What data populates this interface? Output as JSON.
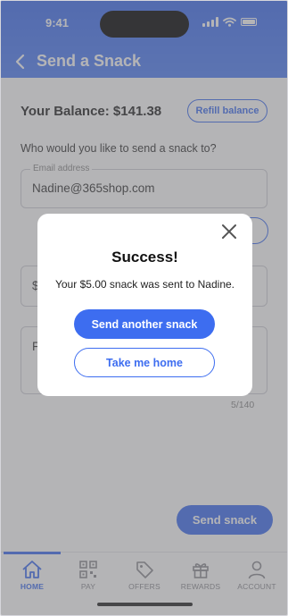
{
  "status_bar": {
    "time": "9:41"
  },
  "header": {
    "title": "Send a Snack"
  },
  "balance": {
    "label": "Your Balance: $141.38",
    "refill_label": "Refill balance"
  },
  "form": {
    "question": "Who would you like to send a snack to?",
    "email_label": "Email address",
    "email_value": "Nadine@365shop.com",
    "amount_fragment": "$",
    "message_fragment": "F",
    "char_counter": "5/140"
  },
  "send_button": "Send snack",
  "tabs": [
    {
      "label": "HOME",
      "icon": "home-icon",
      "active": true
    },
    {
      "label": "PAY",
      "icon": "qr-code-icon",
      "active": false
    },
    {
      "label": "OFFERS",
      "icon": "tag-icon",
      "active": false
    },
    {
      "label": "REWARDS",
      "icon": "gift-icon",
      "active": false
    },
    {
      "label": "ACCOUNT",
      "icon": "person-icon",
      "active": false
    }
  ],
  "modal": {
    "title": "Success!",
    "message": "Your $5.00 snack was sent to Nadine.",
    "primary_button": "Send another snack",
    "secondary_button": "Take me home"
  },
  "colors": {
    "accent": "#3d6df0",
    "overlay": "#69696e"
  }
}
